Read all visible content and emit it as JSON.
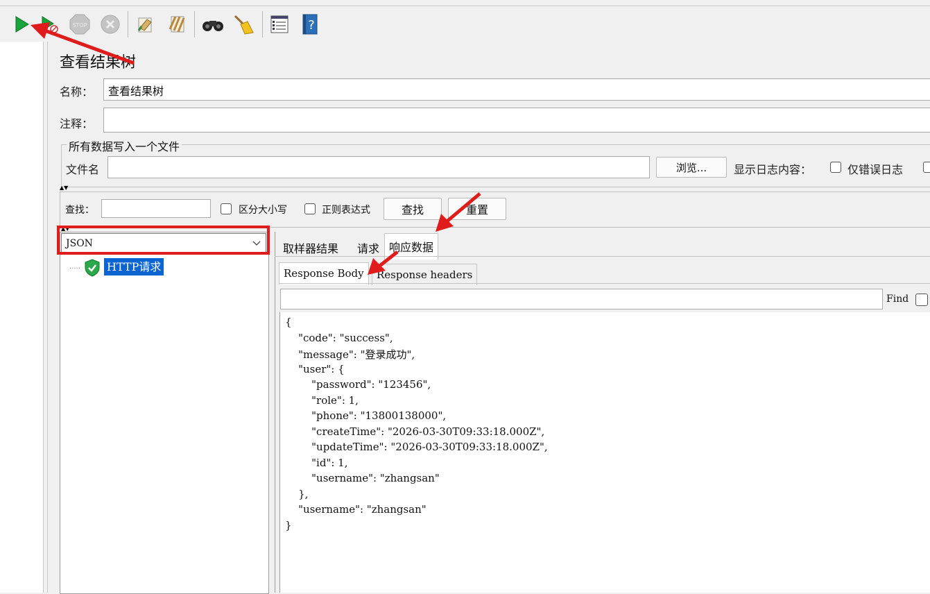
{
  "toolbar": {
    "icons": [
      "start-icon",
      "start-no-pauses-icon",
      "stop-icon",
      "shutdown-icon",
      "clear-icon",
      "clear-all-icon",
      "search-icon",
      "reset-search-icon",
      "function-helper-icon",
      "help-icon"
    ],
    "stop_label": "STOP"
  },
  "panel": {
    "title": "查看结果树",
    "name_label": "名称：",
    "name_value": "查看结果树",
    "comment_label": "注释：",
    "comment_value": ""
  },
  "file_section": {
    "legend": "所有数据写入一个文件",
    "filename_label": "文件名",
    "filename_value": "",
    "browse_label": "浏览...",
    "log_label": "显示日志内容：",
    "errors_only_label": "仅错误日志"
  },
  "search": {
    "label": "查找：",
    "value": "",
    "case_label": "区分大小写",
    "regex_label": "正则表达式",
    "find_button": "查找",
    "reset_button": "重置"
  },
  "renderer": {
    "selected": "JSON"
  },
  "tree": {
    "items": [
      {
        "label": "HTTP请求",
        "status": "success"
      }
    ]
  },
  "result_tabs": {
    "tabs": [
      "取样器结果",
      "请求",
      "响应数据"
    ],
    "active": "响应数据"
  },
  "response_tabs": {
    "tabs": [
      "Response Body",
      "Response headers"
    ],
    "active": "Response Body"
  },
  "find_bar": {
    "value": "",
    "find_label": "Find"
  },
  "response_body": {
    "lines": [
      "{",
      "    \"code\": \"success\",",
      "    \"message\": \"登录成功\",",
      "    \"user\": {",
      "        \"password\": \"123456\",",
      "        \"role\": 1,",
      "        \"phone\": \"13800138000\",",
      "        \"createTime\": \"2026-03-30T09:33:18.000Z\",",
      "        \"updateTime\": \"2026-03-30T09:33:18.000Z\",",
      "        \"id\": 1,",
      "        \"username\": \"zhangsan\"",
      "    },",
      "    \"username\": \"zhangsan\"",
      "}"
    ]
  },
  "colors": {
    "annotation_red": "#e01b1b",
    "selection_blue": "#0a64d2",
    "start_green": "#1aa33a"
  }
}
